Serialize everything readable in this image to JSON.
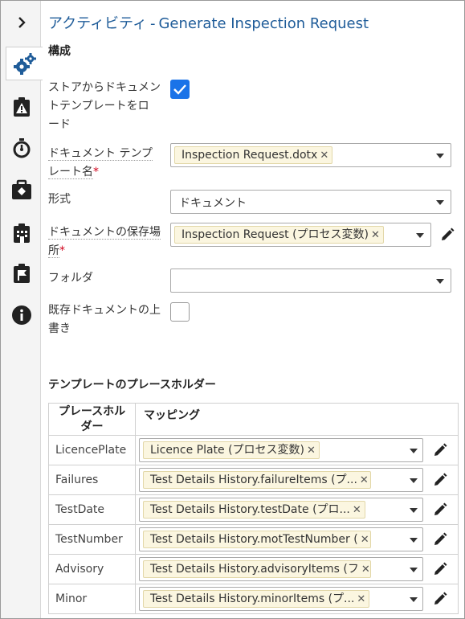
{
  "title": {
    "activity": "アクティビティ",
    "name": "Generate Inspection Request"
  },
  "sidebar": {
    "items": [
      {
        "icon": "chevron-right-icon"
      },
      {
        "icon": "gears-icon",
        "active": true
      },
      {
        "icon": "warning-clipboard-icon"
      },
      {
        "icon": "stopwatch-icon"
      },
      {
        "icon": "case-icon"
      },
      {
        "icon": "building-icon"
      },
      {
        "icon": "flag-clipboard-icon"
      },
      {
        "icon": "info-icon"
      }
    ]
  },
  "config": {
    "heading": "構成",
    "load_from_store": {
      "label_line1": "ストアからドキュメン",
      "label_line2": "トテンプレートをロ",
      "label_line3": "ード",
      "checked": true
    },
    "template_name": {
      "label_line1": "ドキュメント テンプ",
      "label_line2": "レート名",
      "required": "*",
      "value": "Inspection Request.dotx"
    },
    "format": {
      "label": "形式",
      "value": "ドキュメント"
    },
    "save_location": {
      "label_line1": "ドキュメントの保存場",
      "label_line2": "所",
      "required": "*",
      "value": "Inspection Request (プロセス変数)"
    },
    "folder": {
      "label": "フォルダ",
      "value": ""
    },
    "overwrite": {
      "label_line1": "既存ドキュメントの上",
      "label_line2": "書き",
      "checked": false
    }
  },
  "placeholders": {
    "heading": "テンプレートのプレースホルダー",
    "col_placeholder_line1": "プレースホル",
    "col_placeholder_line2": "ダー",
    "col_mapping": "マッピング",
    "rows": [
      {
        "name": "LicencePlate",
        "mapping": "Licence Plate (プロセス変数)"
      },
      {
        "name": "Failures",
        "mapping": "Test Details History.failureItems (プ..."
      },
      {
        "name": "TestDate",
        "mapping": "Test Details History.testDate (プロ..."
      },
      {
        "name": "TestNumber",
        "mapping": "Test Details History.motTestNumber ("
      },
      {
        "name": "Advisory",
        "mapping": "Test Details History.advisoryItems (フ"
      },
      {
        "name": "Minor",
        "mapping": "Test Details History.minorItems (プ..."
      }
    ]
  },
  "colors": {
    "accent": "#1a73e8",
    "title": "#1f5c99",
    "required": "#d0021b",
    "tag_bg": "#fbf6e0"
  }
}
